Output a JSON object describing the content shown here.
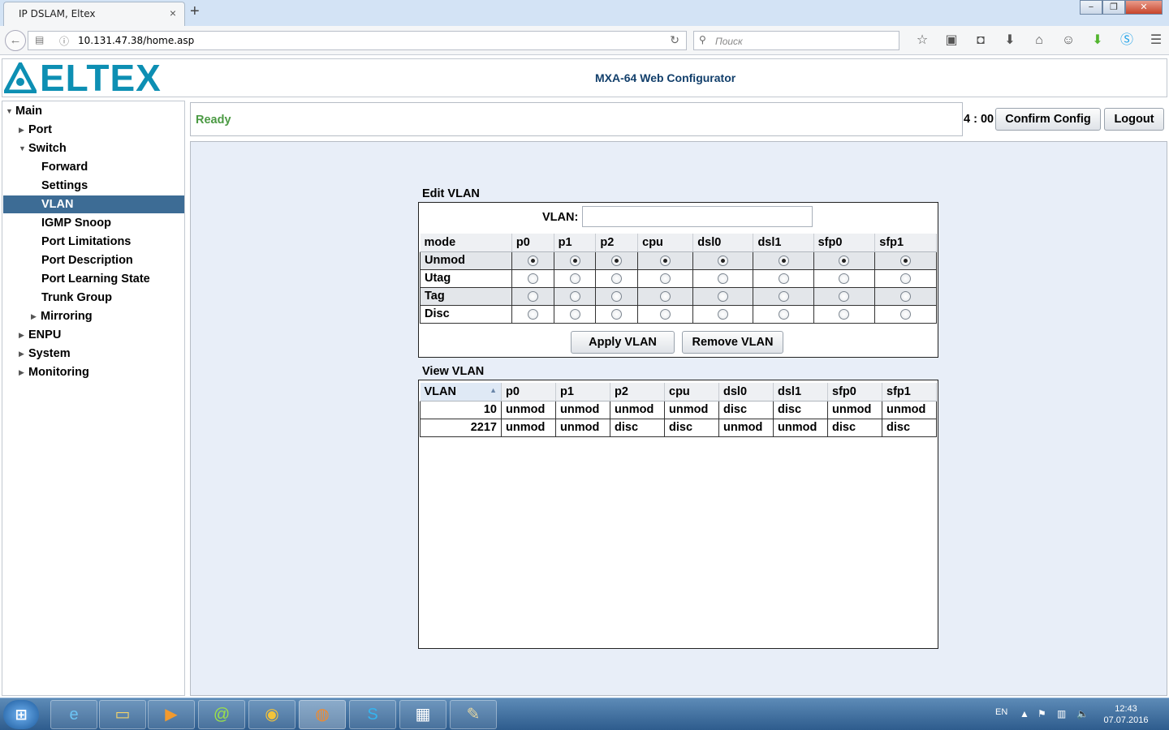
{
  "browser": {
    "tab_title": "IP DSLAM, Eltex",
    "tab_close": "×",
    "new_tab": "+",
    "url": "10.131.47.38/home.asp",
    "search_placeholder": "Поиск",
    "window_buttons": [
      "−",
      "❐",
      "✕"
    ]
  },
  "header": {
    "logo_text": "ELTEX",
    "title": "MXA-64 Web Configurator"
  },
  "sidebar": {
    "items": [
      {
        "label": "Main",
        "expanded": true
      },
      {
        "label": "Port",
        "expanded": false
      },
      {
        "label": "Switch",
        "expanded": true
      },
      {
        "label": "Forward"
      },
      {
        "label": "Settings"
      },
      {
        "label": "VLAN",
        "selected": true
      },
      {
        "label": "IGMP Snoop"
      },
      {
        "label": "Port Limitations"
      },
      {
        "label": "Port Description"
      },
      {
        "label": "Port Learning State"
      },
      {
        "label": "Trunk Group"
      },
      {
        "label": "Mirroring",
        "expanded": false
      },
      {
        "label": "ENPU",
        "expanded": false
      },
      {
        "label": "System",
        "expanded": false
      },
      {
        "label": "Monitoring",
        "expanded": false
      }
    ],
    "selected_color": "#3d6c95"
  },
  "status": {
    "text": "Ready",
    "timer": "4 : 00",
    "confirm_label": "Confirm Config",
    "logout_label": "Logout",
    "status_color": "#4b9a43"
  },
  "edit_vlan": {
    "title": "Edit VLAN",
    "vlan_label": "VLAN:",
    "vlan_value": "",
    "columns": [
      "mode",
      "p0",
      "p1",
      "p2",
      "cpu",
      "dsl0",
      "dsl1",
      "sfp0",
      "sfp1"
    ],
    "rows": [
      {
        "mode": "Unmod",
        "selected": [
          true,
          true,
          true,
          true,
          true,
          true,
          true,
          true
        ]
      },
      {
        "mode": "Utag",
        "selected": [
          false,
          false,
          false,
          false,
          false,
          false,
          false,
          false
        ]
      },
      {
        "mode": "Tag",
        "selected": [
          false,
          false,
          false,
          false,
          false,
          false,
          false,
          false
        ]
      },
      {
        "mode": "Disc",
        "selected": [
          false,
          false,
          false,
          false,
          false,
          false,
          false,
          false
        ]
      }
    ],
    "apply_label": "Apply VLAN",
    "remove_label": "Remove VLAN"
  },
  "view_vlan": {
    "title": "View VLAN",
    "columns": [
      "VLAN",
      "p0",
      "p1",
      "p2",
      "cpu",
      "dsl0",
      "dsl1",
      "sfp0",
      "sfp1"
    ],
    "sort_icon": "▲",
    "rows": [
      [
        "10",
        "unmod",
        "unmod",
        "unmod",
        "unmod",
        "disc",
        "disc",
        "unmod",
        "unmod"
      ],
      [
        "2217",
        "unmod",
        "unmod",
        "disc",
        "disc",
        "unmod",
        "unmod",
        "disc",
        "disc"
      ]
    ]
  },
  "taskbar": {
    "language": "EN",
    "time": "12:43",
    "date": "07.07.2016"
  }
}
